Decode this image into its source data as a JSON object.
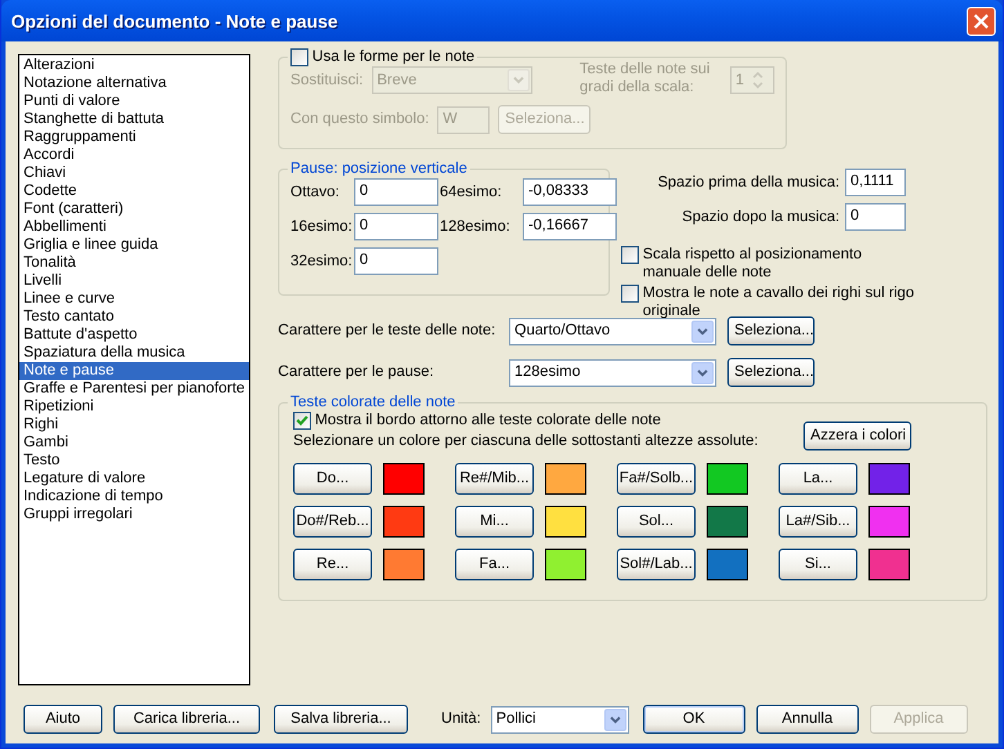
{
  "window": {
    "title": "Opzioni del documento - Note e pause"
  },
  "categories": [
    {
      "label": "Alterazioni",
      "selected": false
    },
    {
      "label": "Notazione alternativa",
      "selected": false
    },
    {
      "label": "Punti di valore",
      "selected": false
    },
    {
      "label": "Stanghette di battuta",
      "selected": false
    },
    {
      "label": "Raggruppamenti",
      "selected": false
    },
    {
      "label": "Accordi",
      "selected": false
    },
    {
      "label": "Chiavi",
      "selected": false
    },
    {
      "label": "Codette",
      "selected": false
    },
    {
      "label": "Font (caratteri)",
      "selected": false
    },
    {
      "label": "Abbellimenti",
      "selected": false
    },
    {
      "label": "Griglia e linee guida",
      "selected": false
    },
    {
      "label": "Tonalità",
      "selected": false
    },
    {
      "label": "Livelli",
      "selected": false
    },
    {
      "label": "Linee e curve",
      "selected": false
    },
    {
      "label": "Testo cantato",
      "selected": false
    },
    {
      "label": "Battute d'aspetto",
      "selected": false
    },
    {
      "label": "Spaziatura della musica",
      "selected": false
    },
    {
      "label": "Note e pause",
      "selected": true
    },
    {
      "label": "Graffe e Parentesi per pianoforte",
      "selected": false
    },
    {
      "label": "Ripetizioni",
      "selected": false
    },
    {
      "label": "Righi",
      "selected": false
    },
    {
      "label": "Gambi",
      "selected": false
    },
    {
      "label": "Testo",
      "selected": false
    },
    {
      "label": "Legature di valore",
      "selected": false
    },
    {
      "label": "Indicazione di tempo",
      "selected": false
    },
    {
      "label": "Gruppi irregolari",
      "selected": false
    }
  ],
  "note_shapes": {
    "label": "Usa le forme per le note",
    "checked": false,
    "disabled": true,
    "replace_label": "Sostituisci:",
    "replace_value": "Breve",
    "scale_label": "Teste delle note sui gradi della scala:",
    "scale_value": "1",
    "symbol_label": "Con questo simbolo:",
    "symbol_value": "W",
    "symbol_button": "Seleziona..."
  },
  "rest_position": {
    "title": "Pause: posizione verticale",
    "fields": [
      {
        "label": "Ottavo:",
        "value": "0"
      },
      {
        "label": "64esimo:",
        "value": "-0,08333"
      },
      {
        "label": "16esimo:",
        "value": "0"
      },
      {
        "label": "128esimo:",
        "value": "-0,16667"
      },
      {
        "label": "32esimo:",
        "value": "0"
      }
    ]
  },
  "spacing": [
    {
      "label": "Spazio prima della musica:",
      "value": "0,1111"
    },
    {
      "label": "Spazio dopo la musica:",
      "value": "0"
    }
  ],
  "options": [
    {
      "label": "Scala rispetto al posizionamento manuale delle note",
      "checked": false
    },
    {
      "label": "Mostra le note a cavallo dei righi sul rigo originale",
      "checked": false
    }
  ],
  "fonts": [
    {
      "label": "Carattere per le teste delle note:",
      "value": "Quarto/Ottavo",
      "button": "Seleziona..."
    },
    {
      "label": "Carattere per le pause:",
      "value": "128esimo",
      "button": "Seleziona..."
    }
  ],
  "colored_heads": {
    "title": "Teste colorate delle note",
    "show_border": {
      "label": "Mostra il bordo attorno alle teste colorate delle note",
      "checked": true
    },
    "hint": "Selezionare un colore per ciascuna delle sottostanti altezze assolute:",
    "reset_button": "Azzera i colori",
    "notes": [
      {
        "label": "Do...",
        "color": "#ff0000"
      },
      {
        "label": "Do#/Reb...",
        "color": "#ff3a12"
      },
      {
        "label": "Re...",
        "color": "#ff7a32"
      },
      {
        "label": "Re#/Mib...",
        "color": "#ffa840"
      },
      {
        "label": "Mi...",
        "color": "#ffe040"
      },
      {
        "label": "Fa...",
        "color": "#90f030"
      },
      {
        "label": "Fa#/Solb...",
        "color": "#12c822"
      },
      {
        "label": "Sol...",
        "color": "#127848"
      },
      {
        "label": "Sol#/Lab...",
        "color": "#1270c0"
      },
      {
        "label": "La...",
        "color": "#7222e8"
      },
      {
        "label": "La#/Sib...",
        "color": "#f030f0"
      },
      {
        "label": "Si...",
        "color": "#f03090"
      }
    ]
  },
  "footer": {
    "buttons": [
      "Aiuto",
      "Carica libreria...",
      "Salva libreria..."
    ],
    "unit_label": "Unità:",
    "unit_value": "Pollici",
    "actions": [
      {
        "label": "OK",
        "disabled": false
      },
      {
        "label": "Annulla",
        "disabled": false
      },
      {
        "label": "Applica",
        "disabled": true
      }
    ]
  }
}
